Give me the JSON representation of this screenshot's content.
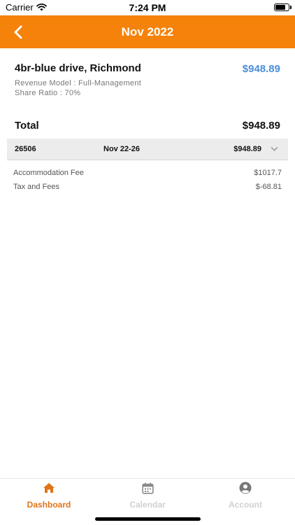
{
  "status_bar": {
    "carrier": "Carrier",
    "time": "7:24 PM",
    "battery_level": 0.85
  },
  "header": {
    "title": "Nov 2022",
    "back_icon": "chevron-left-icon",
    "background_color": "#f5820b"
  },
  "property": {
    "name": "4br-blue drive, Richmond",
    "amount": "$948.89",
    "revenue_model": "Revenue Model : Full-Management",
    "share_ratio": "Share Ratio : 70%",
    "amount_color": "#4a90d9"
  },
  "total": {
    "label": "Total",
    "value": "$948.89"
  },
  "booking": {
    "id": "26506",
    "dates": "Nov 22-26",
    "amount": "$948.89",
    "expand_icon": "chevron-down-icon"
  },
  "fees": [
    {
      "label": "Accommodation Fee",
      "value": "$1017.7"
    },
    {
      "label": "Tax and Fees",
      "value": "$-68.81"
    }
  ],
  "tabs": [
    {
      "label": "Dashboard",
      "icon": "home-icon",
      "active": true
    },
    {
      "label": "Calendar",
      "icon": "calendar-icon",
      "active": false
    },
    {
      "label": "Account",
      "icon": "account-icon",
      "active": false
    }
  ],
  "colors": {
    "accent": "#f5820b",
    "active_tab": "#e07418",
    "inactive_tab": "#d0d0d0"
  }
}
